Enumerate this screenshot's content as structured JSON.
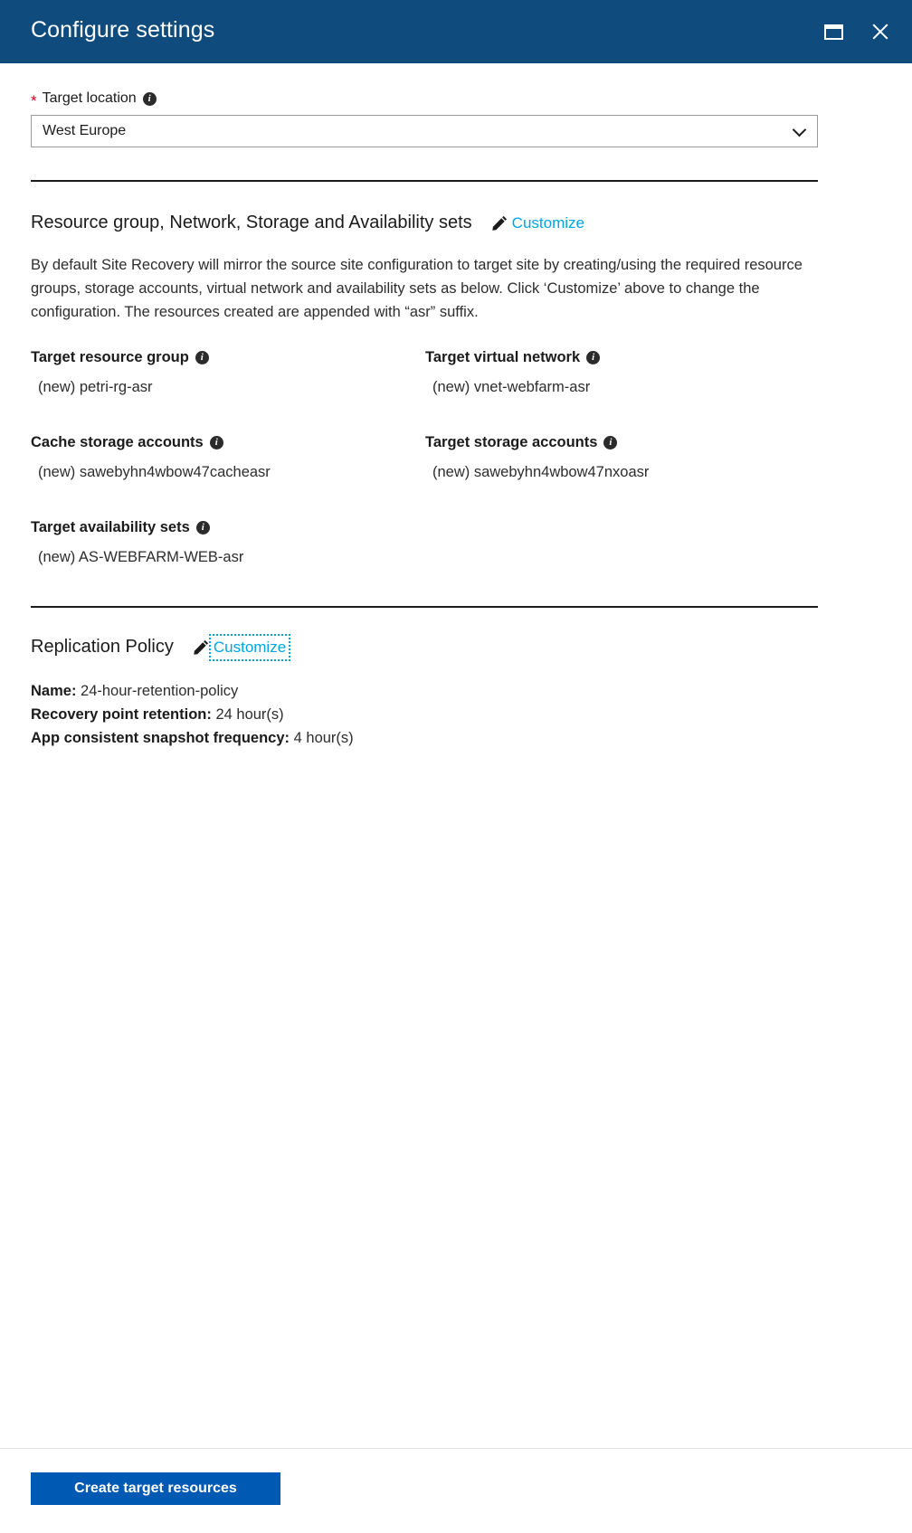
{
  "header": {
    "title": "Configure settings",
    "maximize_icon": "maximize-icon",
    "close_icon": "close-icon"
  },
  "target_location": {
    "required_marker": "*",
    "label": "Target location",
    "info_icon": "info-icon",
    "value": "West Europe",
    "chevron_icon": "chevron-down-icon"
  },
  "resources_section": {
    "heading": "Resource group, Network, Storage and Availability sets",
    "pencil_icon": "pencil-icon",
    "customize_label": "Customize",
    "description": "By default Site Recovery will mirror the source site configuration to target site by creating/using the required resource groups, storage accounts, virtual network and availability sets as below. Click ‘Customize’ above to change the configuration. The resources created are appended with “asr” suffix.",
    "items": [
      {
        "label": "Target resource group",
        "value": "(new) petri-rg-asr"
      },
      {
        "label": "Target virtual network",
        "value": "(new) vnet-webfarm-asr"
      },
      {
        "label": "Cache storage accounts",
        "value": "(new) sawebyhn4wbow47cacheasr"
      },
      {
        "label": "Target storage accounts",
        "value": "(new) sawebyhn4wbow47nxoasr"
      },
      {
        "label": "Target availability sets",
        "value": "(new) AS-WEBFARM-WEB-asr"
      }
    ]
  },
  "replication_policy": {
    "heading": "Replication Policy",
    "pencil_icon": "pencil-icon",
    "customize_label": "Customize",
    "name_label": "Name:",
    "name_value": "24-hour-retention-policy",
    "retention_label": "Recovery point retention:",
    "retention_value": "24 hour(s)",
    "snapshot_label": "App consistent snapshot frequency:",
    "snapshot_value": "4 hour(s)"
  },
  "footer": {
    "primary_button": "Create target resources"
  },
  "colors": {
    "header_blue": "#0f4b7c",
    "link_cyan": "#00a5e5",
    "button_blue": "#0059b3",
    "required_red": "#d0021b"
  }
}
